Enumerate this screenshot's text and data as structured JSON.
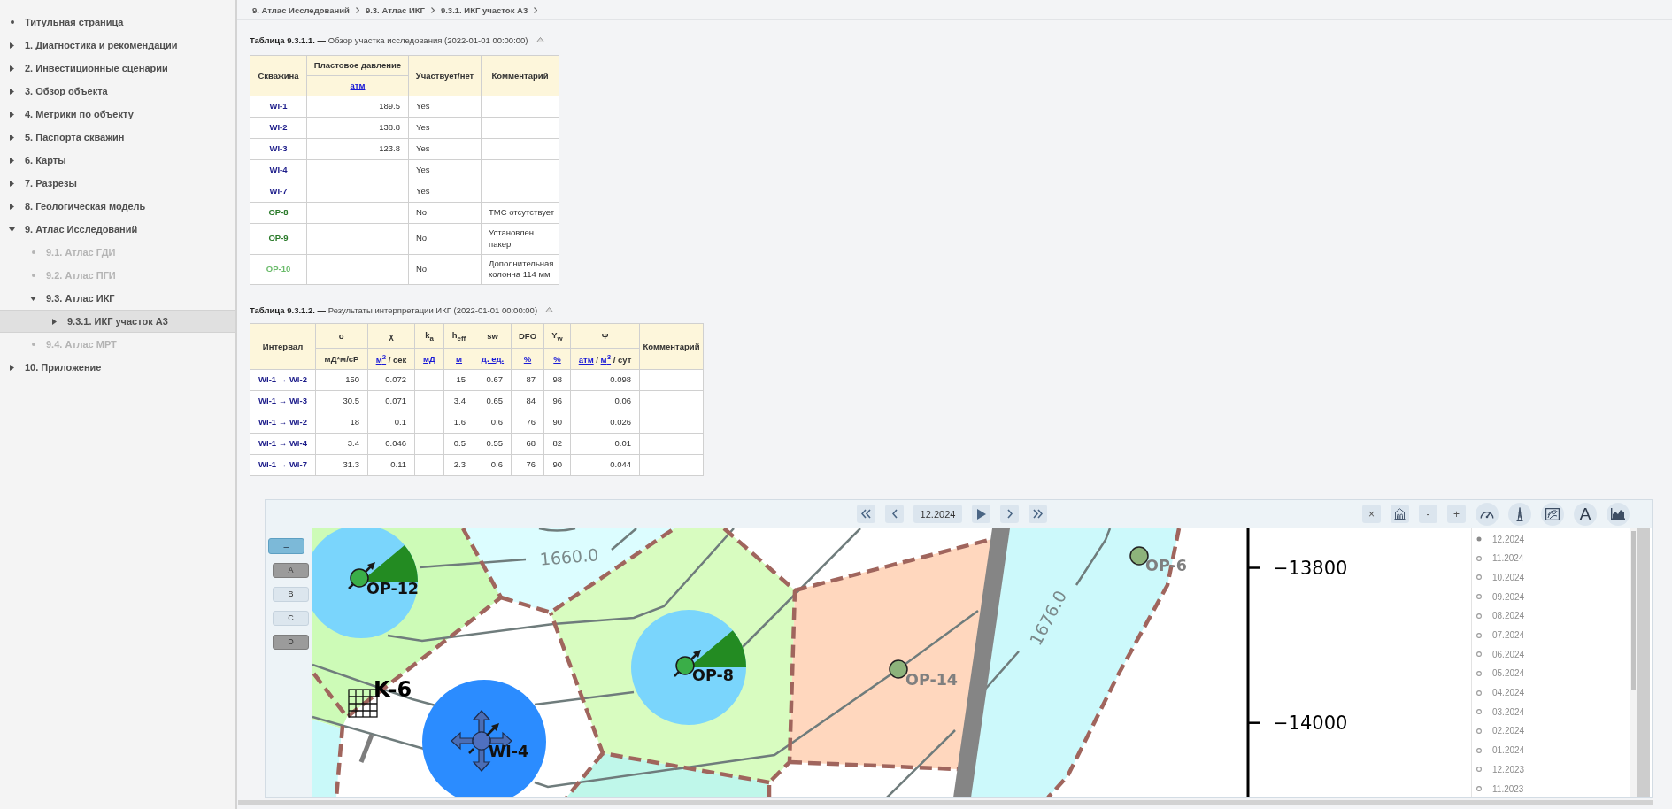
{
  "sidebar": {
    "items": [
      {
        "label": "Титульная страница",
        "kind": "leaf",
        "selected": false,
        "disabled": false
      },
      {
        "label": "1. Диагностика и рекомендации",
        "kind": "branch",
        "expanded": false,
        "selected": false,
        "disabled": false
      },
      {
        "label": "2. Инвестиционные сценарии",
        "kind": "branch",
        "expanded": false,
        "selected": false,
        "disabled": false
      },
      {
        "label": "3. Обзор объекта",
        "kind": "branch",
        "expanded": false,
        "selected": false,
        "disabled": false
      },
      {
        "label": "4. Метрики по объекту",
        "kind": "branch",
        "expanded": false,
        "selected": false,
        "disabled": false
      },
      {
        "label": "5. Паспорта скважин",
        "kind": "branch",
        "expanded": false,
        "selected": false,
        "disabled": false
      },
      {
        "label": "6. Карты",
        "kind": "branch",
        "expanded": false,
        "selected": false,
        "disabled": false
      },
      {
        "label": "7. Разрезы",
        "kind": "branch",
        "expanded": false,
        "selected": false,
        "disabled": false
      },
      {
        "label": "8. Геологическая модель",
        "kind": "branch",
        "expanded": false,
        "selected": false,
        "disabled": false
      },
      {
        "label": "9. Атлас Исследований",
        "kind": "branch",
        "expanded": true,
        "selected": false,
        "disabled": false,
        "children": [
          {
            "label": "9.1. Атлас ГДИ",
            "kind": "leaf",
            "selected": false,
            "disabled": true
          },
          {
            "label": "9.2. Атлас ПГИ",
            "kind": "leaf",
            "selected": false,
            "disabled": true
          },
          {
            "label": "9.3. Атлас ИКГ",
            "kind": "branch",
            "expanded": true,
            "selected": false,
            "disabled": false,
            "children": [
              {
                "label": "9.3.1. ИКГ участок А3",
                "kind": "branch",
                "expanded": false,
                "selected": true,
                "disabled": false
              }
            ]
          },
          {
            "label": "9.4. Атлас МРТ",
            "kind": "leaf",
            "selected": false,
            "disabled": true
          }
        ]
      },
      {
        "label": "10. Приложение",
        "kind": "branch",
        "expanded": false,
        "selected": false,
        "disabled": false
      }
    ]
  },
  "breadcrumb": [
    "9. Атлас Исследований",
    "9.3. Атлас ИКГ",
    "9.3.1. ИКГ участок А3"
  ],
  "tables": [
    {
      "caption": "**Таблица 9.3.1.1. —** Обзор участка исследования (2022-01-01 00:00:00)",
      "expanded": true,
      "columns": [
        {
          "title": "Скважина"
        },
        {
          "title": "Пластовое давление",
          "unit": [
            {
              "text": "атм",
              "link": true
            }
          ]
        },
        {
          "title": "Участвует/нет"
        },
        {
          "title": "Комментарий"
        }
      ],
      "rows": [
        {
          "color": "#1c1c8a",
          "cells": [
            "WI-1",
            "189.5",
            "Yes",
            ""
          ]
        },
        {
          "color": "#1c1c8a",
          "cells": [
            "WI-2",
            "138.8",
            "Yes",
            ""
          ]
        },
        {
          "color": "#1c1c8a",
          "cells": [
            "WI-3",
            "123.8",
            "Yes",
            ""
          ]
        },
        {
          "color": "#1c1c8a",
          "cells": [
            "WI-4",
            "",
            "Yes",
            ""
          ]
        },
        {
          "color": "#1c1c8a",
          "cells": [
            "WI-7",
            "",
            "Yes",
            ""
          ]
        },
        {
          "color": "#2a7a2a",
          "cells": [
            "OP-8",
            "",
            "No",
            "ТМС отсутствует"
          ]
        },
        {
          "color": "#2a7a2a",
          "cells": [
            "OP-9",
            "",
            "No",
            "Установлен пакер"
          ]
        },
        {
          "color": "#6abb6a",
          "cells": [
            "OP-10",
            "",
            "No",
            "Дополнительная колонна 114 мм"
          ]
        }
      ]
    },
    {
      "caption": "**Таблица 9.3.1.2. —** Результаты интерпретации ИКГ (2022-01-01 00:00:00)",
      "expanded": true,
      "columns": [
        {
          "title": "Интервал"
        },
        {
          "title": "σ",
          "unit": [
            {
              "text": "мД*м/сР",
              "link": false
            }
          ]
        },
        {
          "title": "χ",
          "unit": [
            {
              "text": "м$^{2}$",
              "link": true
            },
            {
              "text": " / сек",
              "link": false
            }
          ]
        },
        {
          "title": "k$_{a}$",
          "unit": [
            {
              "text": "мД",
              "link": true
            }
          ]
        },
        {
          "title": "h$_{eff}$",
          "unit": [
            {
              "text": "м",
              "link": true
            }
          ]
        },
        {
          "title": "sw",
          "unit": [
            {
              "text": "д. ед.",
              "link": true
            }
          ]
        },
        {
          "title": "DFO",
          "unit": [
            {
              "text": "%",
              "link": true
            }
          ]
        },
        {
          "title": "Y$_{w}$",
          "unit": [
            {
              "text": "%",
              "link": true
            }
          ]
        },
        {
          "title": "Ψ",
          "unit": [
            {
              "text": "атм",
              "link": true
            },
            {
              "text": " / ",
              "link": false
            },
            {
              "text": "м$^{3}$",
              "link": true
            },
            {
              "text": " / сут",
              "link": false
            }
          ]
        },
        {
          "title": "Комментарий"
        }
      ],
      "rows": [
        {
          "cells": [
            "WI-1 → WI-2",
            "150",
            "0.072",
            "",
            "15",
            "0.67",
            "87",
            "98",
            "0.098",
            ""
          ]
        },
        {
          "cells": [
            "WI-1 → WI-3",
            "30.5",
            "0.071",
            "",
            "3.4",
            "0.65",
            "84",
            "96",
            "0.06",
            ""
          ]
        },
        {
          "cells": [
            "WI-1 → WI-2",
            "18",
            "0.1",
            "",
            "1.6",
            "0.6",
            "76",
            "90",
            "0.026",
            ""
          ]
        },
        {
          "cells": [
            "WI-1 → WI-4",
            "3.4",
            "0.046",
            "",
            "0.5",
            "0.55",
            "68",
            "82",
            "0.01",
            ""
          ]
        },
        {
          "cells": [
            "WI-1 → WI-7",
            "31.3",
            "0.11",
            "",
            "2.3",
            "0.6",
            "76",
            "90",
            "0.044",
            ""
          ]
        }
      ]
    }
  ],
  "map_panel": {
    "date": "12.2024",
    "playing": false,
    "tools": [
      {
        "kind": "text",
        "label": "×"
      },
      {
        "kind": "icon"
      },
      {
        "kind": "text",
        "label": "-"
      },
      {
        "kind": "text",
        "label": "+"
      },
      {
        "kind": "round"
      },
      {
        "kind": "round"
      },
      {
        "kind": "round"
      },
      {
        "kind": "letter",
        "label": "A"
      },
      {
        "kind": "round"
      }
    ],
    "collapse_label": "–",
    "layers": [
      {
        "label": "A",
        "selected": true
      },
      {
        "label": "B",
        "selected": false
      },
      {
        "label": "C",
        "selected": false
      },
      {
        "label": "D",
        "selected": true
      }
    ],
    "map": {
      "wells": [
        {
          "name": "OP-12",
          "kind": "bubble"
        },
        {
          "name": "OP-8",
          "kind": "bubble"
        },
        {
          "name": "WI-4",
          "kind": "injector"
        },
        {
          "name": "OP-14",
          "kind": "point"
        },
        {
          "name": "OP-6",
          "kind": "point"
        }
      ],
      "grid_label": "K-6",
      "contour_labels": [
        "1660.0",
        "1676.0"
      ],
      "axis_ticks": [
        "−13800",
        "−14000"
      ]
    },
    "dates": [
      {
        "label": "12.2024",
        "selected": true
      },
      {
        "label": "11.2024",
        "selected": false
      },
      {
        "label": "10.2024",
        "selected": false
      },
      {
        "label": "09.2024",
        "selected": false
      },
      {
        "label": "08.2024",
        "selected": false
      },
      {
        "label": "07.2024",
        "selected": false
      },
      {
        "label": "06.2024",
        "selected": false
      },
      {
        "label": "05.2024",
        "selected": false
      },
      {
        "label": "04.2024",
        "selected": false
      },
      {
        "label": "03.2024",
        "selected": false
      },
      {
        "label": "02.2024",
        "selected": false
      },
      {
        "label": "01.2024",
        "selected": false
      },
      {
        "label": "12.2023",
        "selected": false
      },
      {
        "label": "11.2023",
        "selected": false
      }
    ]
  }
}
